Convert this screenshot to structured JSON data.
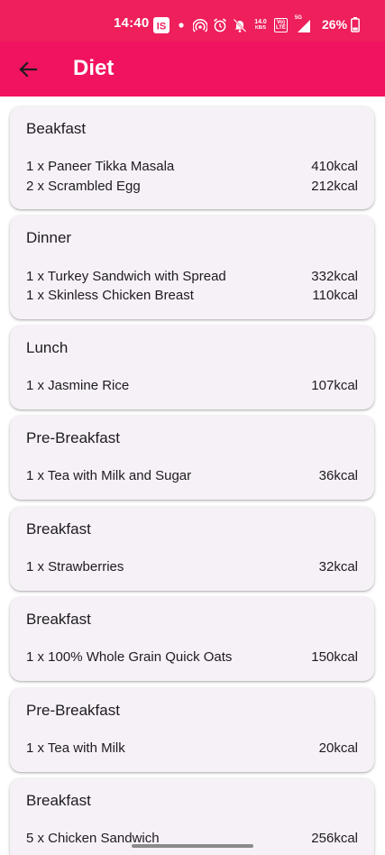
{
  "status_bar": {
    "time": "14:40",
    "speed_value": "14.0",
    "speed_unit": "KB/S",
    "volte_top": "Vo)",
    "volte_bottom": "LTE",
    "network": "5G",
    "battery": "26%",
    "icons": [
      "is-app-icon",
      "dot-icon",
      "hotspot-icon",
      "alarm-icon",
      "mute-icon",
      "signal-icon",
      "battery-icon"
    ]
  },
  "app_bar": {
    "back_icon": "arrow-left-icon",
    "title": "Diet"
  },
  "colors": {
    "status_bar": "#ee1f5b",
    "app_bar": "#f1135f",
    "card_background": "#f6f1f7",
    "text": "#1e1b1f"
  },
  "meals": [
    {
      "title": "Beakfast",
      "items": [
        {
          "name": "1 x Paneer Tikka Masala",
          "kcal": "410kcal"
        },
        {
          "name": "2 x Scrambled Egg",
          "kcal": "212kcal"
        }
      ]
    },
    {
      "title": "Dinner",
      "items": [
        {
          "name": "1 x Turkey Sandwich with Spread",
          "kcal": "332kcal"
        },
        {
          "name": "1 x Skinless Chicken Breast",
          "kcal": "110kcal"
        }
      ]
    },
    {
      "title": "Lunch",
      "items": [
        {
          "name": "1 x Jasmine Rice",
          "kcal": "107kcal"
        }
      ]
    },
    {
      "title": "Pre-Breakfast",
      "items": [
        {
          "name": "1 x Tea with Milk and Sugar",
          "kcal": "36kcal"
        }
      ]
    },
    {
      "title": "Breakfast",
      "items": [
        {
          "name": "1 x Strawberries",
          "kcal": "32kcal"
        }
      ]
    },
    {
      "title": "Breakfast",
      "items": [
        {
          "name": "1 x 100% Whole Grain Quick Oats",
          "kcal": "150kcal"
        }
      ]
    },
    {
      "title": "Pre-Breakfast",
      "items": [
        {
          "name": "1 x Tea with Milk",
          "kcal": "20kcal"
        }
      ]
    },
    {
      "title": "Breakfast",
      "items": [
        {
          "name": "5 x Chicken Sandwich",
          "kcal": "256kcal"
        }
      ]
    }
  ]
}
